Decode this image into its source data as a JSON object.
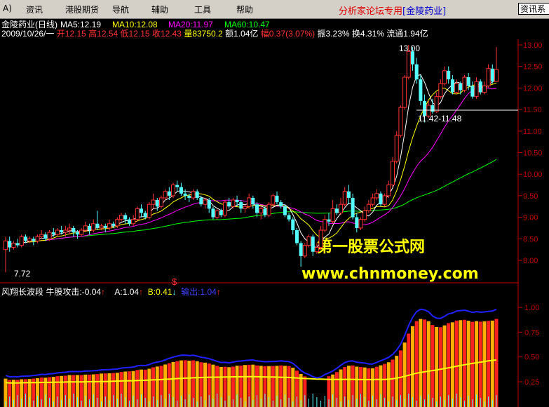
{
  "menubar": {
    "items": [
      "资讯",
      "港股期货",
      "导航",
      "辅助",
      "工具",
      "帮助"
    ],
    "brand_text": "分析家论坛专用",
    "brand_stock": "[金陵药业]",
    "right_button": "资讯系"
  },
  "main_header": {
    "title": "金陵药业(日线)",
    "ma": [
      {
        "label": "MA5:12.19",
        "color": "#ffffff"
      },
      {
        "label": "MA10:12.08",
        "color": "#ffff00"
      },
      {
        "label": "MA20:11.97",
        "color": "#ff00ff"
      },
      {
        "label": "MA60:10.47",
        "color": "#00ff00"
      }
    ]
  },
  "quote_line": {
    "date": "2009/10/26/一",
    "open_label": "开",
    "open": "12.15",
    "high_label": "高",
    "high": "12.54",
    "low_label": "低",
    "low": "12.15",
    "close_label": "收",
    "close": "12.43",
    "vol_label": "量",
    "vol": "83750.2",
    "amt_label": "额",
    "amt": "1.04亿",
    "chg_label": "幅",
    "chg": "0.37(3.07%)",
    "amp": "振3.23%",
    "turnover": "换4.31%",
    "float": "流通1.94亿"
  },
  "annotations": {
    "peak": "13.00",
    "range": "11.42-11.48",
    "low": "7.72",
    "marker": "$"
  },
  "watermark": {
    "line1": "第一股票公式网",
    "line2": "www.chnmoney.com"
  },
  "y_axis_main": [
    "13.00",
    "12.50",
    "12.00",
    "11.50",
    "11.00",
    "10.50",
    "10.00",
    "9.50",
    "9.00",
    "8.50",
    "8.00"
  ],
  "indicator_header": {
    "name": "风翔长波段",
    "sub": "牛股攻击:-0.04",
    "a": "A:1.04",
    "b": "B:0.41",
    "out": "输出:1.04"
  },
  "y_axis_indicator": [
    "1.00",
    "0.75",
    "0.50",
    "0.25"
  ],
  "colors": {
    "up": "#ff3232",
    "down": "#54ffff",
    "ma5": "#ffffff",
    "ma10": "#ffff00",
    "ma20": "#ff00ff",
    "ma60": "#00ff00",
    "axis": "#c00000"
  },
  "chart_data": {
    "type": "candlestick",
    "price_range": [
      7.6,
      13.2
    ],
    "candles": [
      [
        8.25,
        8.45,
        7.72,
        8.55
      ],
      [
        8.45,
        8.3,
        8.2,
        8.55
      ],
      [
        8.3,
        8.4,
        8.25,
        8.45
      ],
      [
        8.4,
        8.35,
        8.3,
        8.5
      ],
      [
        8.35,
        8.55,
        8.3,
        8.6
      ],
      [
        8.55,
        8.45,
        8.4,
        8.6
      ],
      [
        8.45,
        8.5,
        8.4,
        8.55
      ],
      [
        8.5,
        8.45,
        8.35,
        8.55
      ],
      [
        8.45,
        8.55,
        8.4,
        8.6
      ],
      [
        8.55,
        8.6,
        8.5,
        8.7
      ],
      [
        8.6,
        8.5,
        8.45,
        8.65
      ],
      [
        8.5,
        8.65,
        8.45,
        8.7
      ],
      [
        8.65,
        8.6,
        8.55,
        8.75
      ],
      [
        8.6,
        8.7,
        8.55,
        8.75
      ],
      [
        8.7,
        8.65,
        8.6,
        8.8
      ],
      [
        8.65,
        8.7,
        8.55,
        8.8
      ],
      [
        8.7,
        8.75,
        8.6,
        8.85
      ],
      [
        8.75,
        8.65,
        8.55,
        8.8
      ],
      [
        8.65,
        8.6,
        8.5,
        8.7
      ],
      [
        8.6,
        8.7,
        8.55,
        8.75
      ],
      [
        8.7,
        8.8,
        8.65,
        8.9
      ],
      [
        8.8,
        8.7,
        8.6,
        8.85
      ],
      [
        8.7,
        8.85,
        8.65,
        8.95
      ],
      [
        8.85,
        8.75,
        8.7,
        9.15
      ],
      [
        8.75,
        8.8,
        8.7,
        8.85
      ],
      [
        8.8,
        8.75,
        8.65,
        8.85
      ],
      [
        8.75,
        8.85,
        8.7,
        8.95
      ],
      [
        8.85,
        8.8,
        8.75,
        8.9
      ],
      [
        8.8,
        8.95,
        8.75,
        9.0
      ],
      [
        8.95,
        9.05,
        8.9,
        9.1
      ],
      [
        9.05,
        8.95,
        8.85,
        9.1
      ],
      [
        8.95,
        8.85,
        8.8,
        9.0
      ],
      [
        8.85,
        8.95,
        8.8,
        9.05
      ],
      [
        8.95,
        9.2,
        8.9,
        9.25
      ],
      [
        9.2,
        9.1,
        9.0,
        9.3
      ],
      [
        9.1,
        9.0,
        8.95,
        9.15
      ],
      [
        9.0,
        9.3,
        8.95,
        9.35
      ],
      [
        9.3,
        9.4,
        9.2,
        9.55
      ],
      [
        9.4,
        9.25,
        9.15,
        9.45
      ],
      [
        9.25,
        9.45,
        9.2,
        9.5
      ],
      [
        9.45,
        9.6,
        9.4,
        9.65
      ],
      [
        9.6,
        9.5,
        9.4,
        9.7
      ],
      [
        9.5,
        9.75,
        9.45,
        9.8
      ],
      [
        9.75,
        9.7,
        9.6,
        9.85
      ],
      [
        9.7,
        9.55,
        9.5,
        9.8
      ],
      [
        9.55,
        9.5,
        9.4,
        9.65
      ],
      [
        9.5,
        9.45,
        9.35,
        9.55
      ],
      [
        9.45,
        9.6,
        9.4,
        9.65
      ],
      [
        9.6,
        9.45,
        9.4,
        9.65
      ],
      [
        9.45,
        9.3,
        9.25,
        9.5
      ],
      [
        9.3,
        9.4,
        9.2,
        9.45
      ],
      [
        9.4,
        9.2,
        9.1,
        9.45
      ],
      [
        9.2,
        9.0,
        8.95,
        9.25
      ],
      [
        9.0,
        9.15,
        8.95,
        9.2
      ],
      [
        9.15,
        9.05,
        9.0,
        9.2
      ],
      [
        9.05,
        9.35,
        9.0,
        9.4
      ],
      [
        9.35,
        9.25,
        9.2,
        9.45
      ],
      [
        9.25,
        9.4,
        9.2,
        9.45
      ],
      [
        9.4,
        9.35,
        9.25,
        9.5
      ],
      [
        9.35,
        9.2,
        9.1,
        9.4
      ],
      [
        9.2,
        9.25,
        9.1,
        9.3
      ],
      [
        9.25,
        9.45,
        9.2,
        9.55
      ],
      [
        9.45,
        9.3,
        9.2,
        9.5
      ],
      [
        9.3,
        9.1,
        9.0,
        9.35
      ],
      [
        9.1,
        9.2,
        8.95,
        9.25
      ],
      [
        9.2,
        9.05,
        9.0,
        9.25
      ],
      [
        9.05,
        9.3,
        9.0,
        9.35
      ],
      [
        9.3,
        9.5,
        9.25,
        9.55
      ],
      [
        9.5,
        9.35,
        9.3,
        9.6
      ],
      [
        9.35,
        9.25,
        9.2,
        9.4
      ],
      [
        9.25,
        9.05,
        9.0,
        9.3
      ],
      [
        9.05,
        8.95,
        8.9,
        9.1
      ],
      [
        8.95,
        8.7,
        8.6,
        9.0
      ],
      [
        8.7,
        8.4,
        8.35,
        8.75
      ],
      [
        8.4,
        8.1,
        7.85,
        8.45
      ],
      [
        8.1,
        8.35,
        8.05,
        8.4
      ],
      [
        8.35,
        8.55,
        8.3,
        8.6
      ],
      [
        8.55,
        8.2,
        8.1,
        8.6
      ],
      [
        8.2,
        8.3,
        8.15,
        8.4
      ],
      [
        8.3,
        8.7,
        8.25,
        8.8
      ],
      [
        8.7,
        8.95,
        8.65,
        9.05
      ],
      [
        8.95,
        8.9,
        8.8,
        9.1
      ],
      [
        8.9,
        9.2,
        8.85,
        9.4
      ],
      [
        9.2,
        9.1,
        9.05,
        9.3
      ],
      [
        9.1,
        9.3,
        9.05,
        9.45
      ],
      [
        9.3,
        9.6,
        9.25,
        9.7
      ],
      [
        9.6,
        9.45,
        9.3,
        9.75
      ],
      [
        9.45,
        9.0,
        8.95,
        9.55
      ],
      [
        9.0,
        8.75,
        8.65,
        9.1
      ],
      [
        8.75,
        8.95,
        8.7,
        9.0
      ],
      [
        8.95,
        9.15,
        8.9,
        9.25
      ],
      [
        9.15,
        9.3,
        9.1,
        9.4
      ],
      [
        9.3,
        9.45,
        9.25,
        9.55
      ],
      [
        9.45,
        9.55,
        9.4,
        9.65
      ],
      [
        9.55,
        9.3,
        9.25,
        9.6
      ],
      [
        9.3,
        9.5,
        9.25,
        9.55
      ],
      [
        9.5,
        9.75,
        9.45,
        9.85
      ],
      [
        9.75,
        10.3,
        9.7,
        10.4
      ],
      [
        10.3,
        10.9,
        10.25,
        11.0
      ],
      [
        10.9,
        11.55,
        10.85,
        11.6
      ],
      [
        11.55,
        12.25,
        11.5,
        12.3
      ],
      [
        12.25,
        12.85,
        12.2,
        13.0
      ],
      [
        12.85,
        12.55,
        12.4,
        12.95
      ],
      [
        12.55,
        12.2,
        12.1,
        12.7
      ],
      [
        12.2,
        11.7,
        11.6,
        12.3
      ],
      [
        11.7,
        11.35,
        11.2,
        11.85
      ],
      [
        11.35,
        11.6,
        11.3,
        11.7
      ],
      [
        11.6,
        11.45,
        11.4,
        11.75
      ],
      [
        11.45,
        11.8,
        11.42,
        11.9
      ],
      [
        11.8,
        12.1,
        11.75,
        12.2
      ],
      [
        12.1,
        12.4,
        12.05,
        12.5
      ],
      [
        12.4,
        12.2,
        12.1,
        12.5
      ],
      [
        12.2,
        11.9,
        11.85,
        12.3
      ],
      [
        11.9,
        12.1,
        11.85,
        12.2
      ],
      [
        12.1,
        11.95,
        11.85,
        12.15
      ],
      [
        11.95,
        12.25,
        11.9,
        12.3
      ],
      [
        12.25,
        12.05,
        11.95,
        12.35
      ],
      [
        12.05,
        11.8,
        11.75,
        12.15
      ],
      [
        11.8,
        12.15,
        11.75,
        12.25
      ],
      [
        12.15,
        11.9,
        11.85,
        12.2
      ],
      [
        11.9,
        12.05,
        11.85,
        12.15
      ],
      [
        12.05,
        12.45,
        12.0,
        12.55
      ],
      [
        12.45,
        12.15,
        12.1,
        12.55
      ],
      [
        12.15,
        12.43,
        12.15,
        12.95
      ]
    ]
  }
}
